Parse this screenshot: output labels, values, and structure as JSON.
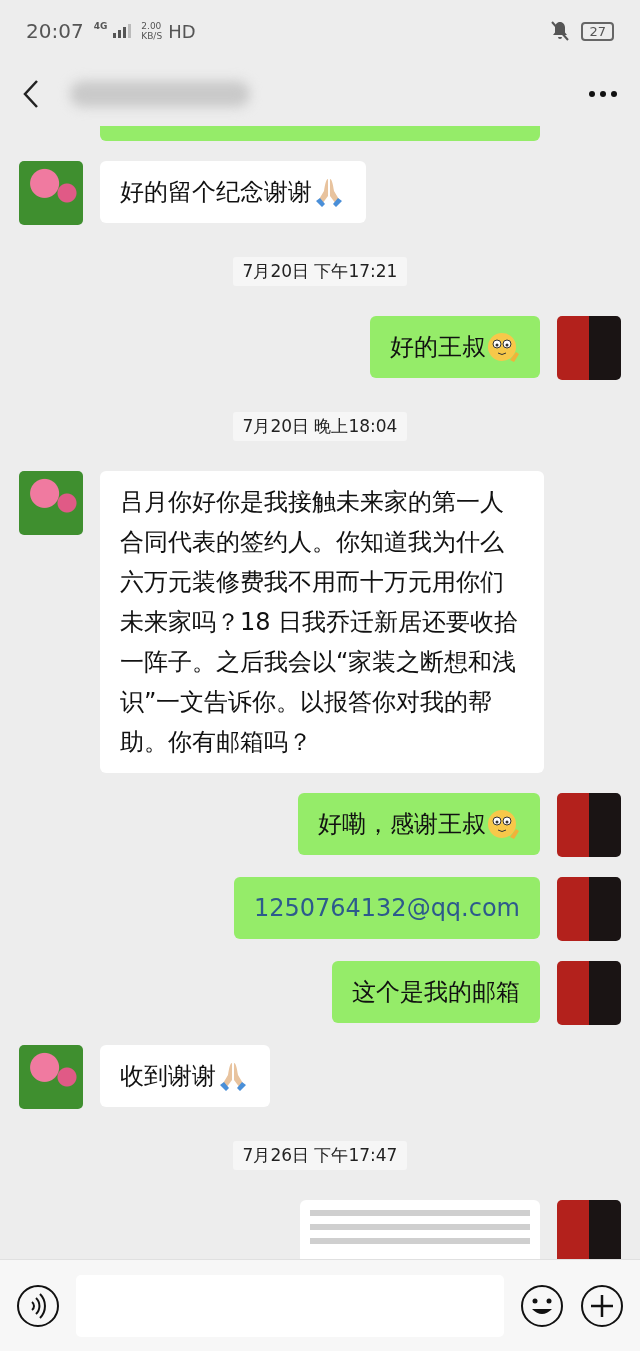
{
  "status_bar": {
    "time": "20:07",
    "network": "4G",
    "speed_value": "2.00",
    "speed_unit": "KB/S",
    "hd": "HD",
    "battery": "27"
  },
  "nav": {
    "title_blurred": true
  },
  "messages": [
    {
      "kind": "clipped",
      "outgoing": true
    },
    {
      "kind": "text",
      "outgoing": false,
      "text": "好的留个纪念谢谢",
      "pray_emoji": true
    },
    {
      "kind": "time",
      "text": "7月20日 下午17:21"
    },
    {
      "kind": "text",
      "outgoing": true,
      "text": "好的王叔",
      "thinking_emoji": true
    },
    {
      "kind": "time",
      "text": "7月20日 晚上18:04"
    },
    {
      "kind": "text",
      "outgoing": false,
      "text": "吕月你好你是我接触未来家的第一人合同代表的签约人。你知道我为什么六万元装修费我不用而十万元用你们未来家吗？18 日我乔迁新居还要收拾一阵子。之后我会以“家装之断想和浅识”一文告诉你。以报答你对我的帮助。你有邮箱吗？"
    },
    {
      "kind": "text",
      "outgoing": true,
      "text": "好嘞，感谢王叔",
      "thinking_emoji": true
    },
    {
      "kind": "link",
      "outgoing": true,
      "text": "1250764132@qq.com"
    },
    {
      "kind": "text",
      "outgoing": true,
      "text": "这个是我的邮箱"
    },
    {
      "kind": "text",
      "outgoing": false,
      "text": "收到谢谢",
      "pray_emoji": true
    },
    {
      "kind": "time",
      "text": "7月26日 下午17:47"
    },
    {
      "kind": "image",
      "outgoing": true
    }
  ]
}
